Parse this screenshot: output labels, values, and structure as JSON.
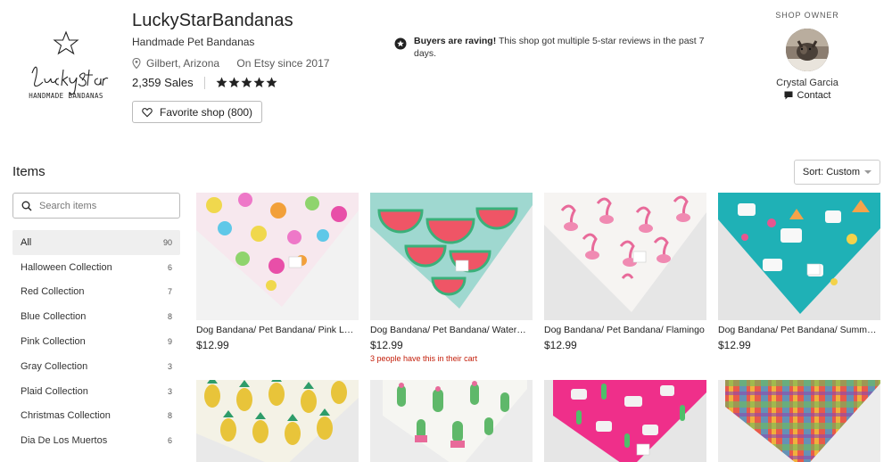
{
  "shop": {
    "name": "LuckyStarBandanas",
    "tagline": "Handmade Pet Bandanas",
    "location": "Gilbert, Arizona",
    "since": "On Etsy since 2017",
    "sales": "2,359 Sales",
    "rating_stars": 5,
    "favorite_label": "Favorite shop (800)",
    "logo": {
      "line1": "Lucky Star",
      "line2": "HANDMADE BANDANAS"
    }
  },
  "raving": {
    "bold": "Buyers are raving!",
    "text": " This shop got multiple 5-star reviews in the past 7 days."
  },
  "owner": {
    "label": "SHOP OWNER",
    "name": "Crystal Garcia",
    "contact": "Contact"
  },
  "items": {
    "heading": "Items",
    "sort_label": "Sort: Custom",
    "search_placeholder": "Search items",
    "categories": [
      {
        "label": "All",
        "count": "90"
      },
      {
        "label": "Halloween Collection",
        "count": "6"
      },
      {
        "label": "Red Collection",
        "count": "7"
      },
      {
        "label": "Blue Collection",
        "count": "8"
      },
      {
        "label": "Pink Collection",
        "count": "9"
      },
      {
        "label": "Gray Collection",
        "count": "3"
      },
      {
        "label": "Plaid Collection",
        "count": "3"
      },
      {
        "label": "Christmas Collection",
        "count": "8"
      },
      {
        "label": "Dia De Los Muertos",
        "count": "6"
      }
    ],
    "products": [
      {
        "title": "Dog Bandana/ Pet Bandana/ Pink Lemonade",
        "price": "$12.99",
        "note": ""
      },
      {
        "title": "Dog Bandana/ Pet Bandana/ Watermelon",
        "price": "$12.99",
        "note": "3 people have this in their cart"
      },
      {
        "title": "Dog Bandana/ Pet Bandana/ Flamingo",
        "price": "$12.99",
        "note": ""
      },
      {
        "title": "Dog Bandana/ Pet Bandana/ Summer Llama",
        "price": "$12.99",
        "note": ""
      }
    ]
  },
  "colors": {
    "accent_text": "#222222",
    "cart_note": "#c4200c",
    "active_category_bg": "#efefef"
  }
}
